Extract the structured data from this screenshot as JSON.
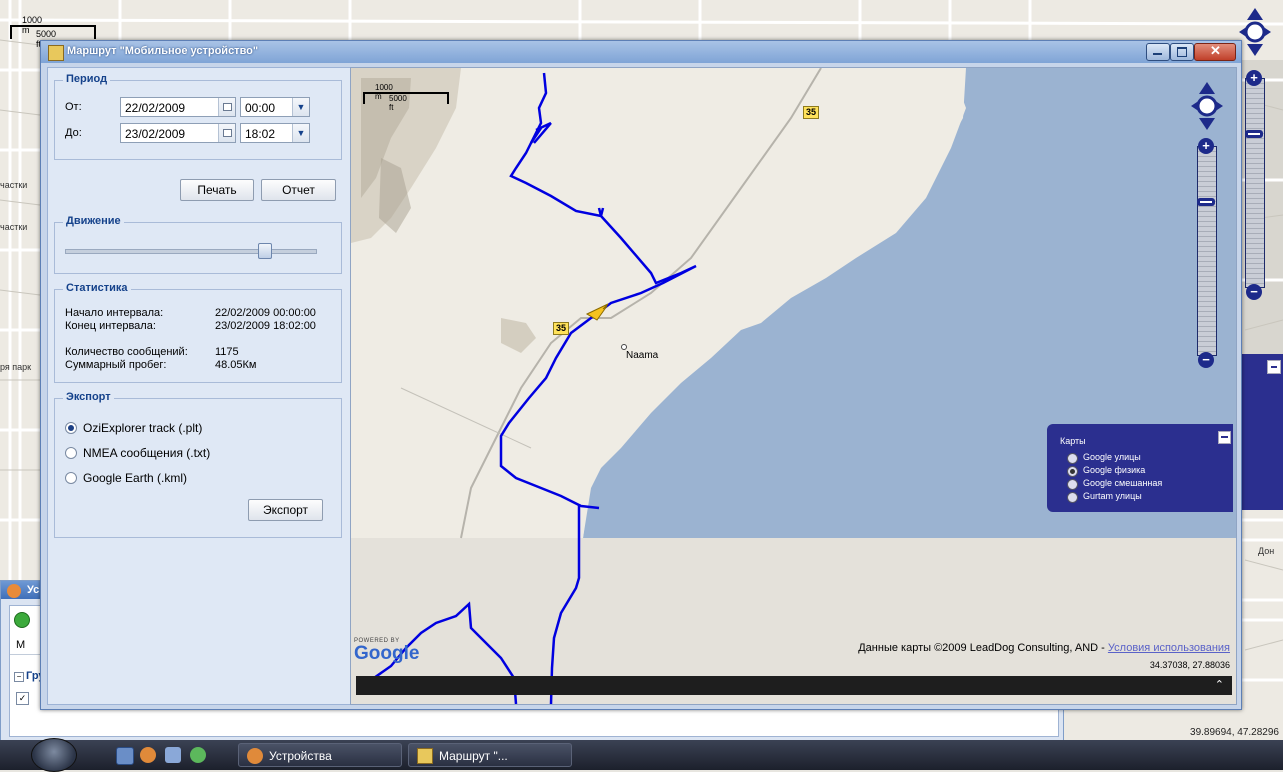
{
  "window": {
    "title": "Маршрут \"Мобильное устройство\""
  },
  "period": {
    "legend": "Период",
    "from_label": "От:",
    "from_date": "22/02/2009",
    "from_time": "00:00",
    "to_label": "До:",
    "to_date": "23/02/2009",
    "to_time": "18:02",
    "print_label": "Печать",
    "report_label": "Отчет"
  },
  "movement": {
    "legend": "Движение",
    "slider_position": 0.82
  },
  "stats": {
    "legend": "Статистика",
    "rows": [
      {
        "label": "Начало интервала:",
        "value": "22/02/2009 00:00:00"
      },
      {
        "label": "Конец интервала:",
        "value": "23/02/2009 18:02:00"
      },
      {
        "label": "Количество сообщений:",
        "value": "1175"
      },
      {
        "label": "Суммарный пробег:",
        "value": "48.05Км"
      }
    ]
  },
  "export": {
    "legend": "Экспорт",
    "options": [
      {
        "label": "OziExplorer track (.plt)",
        "selected": true
      },
      {
        "label": "NMEA сообщения (.txt)",
        "selected": false
      },
      {
        "label": "Google Earth (.kml)",
        "selected": false
      }
    ],
    "button_label": "Экспорт"
  },
  "map": {
    "scale_m": "1000 m",
    "scale_ft": "5000 ft",
    "road_label": "35",
    "place_label": "Naama",
    "layers_title": "Карты",
    "layers": [
      {
        "label": "Google улицы",
        "selected": false
      },
      {
        "label": "Google физика",
        "selected": true
      },
      {
        "label": "Google смешанная",
        "selected": false
      },
      {
        "label": "Gurtam улицы",
        "selected": false
      }
    ],
    "attribution": "Данные карты ©2009 LeadDog Consulting, AND - ",
    "terms_link": "Условия использования",
    "coords": "34.37038, 27.88036",
    "powered_by": "POWERED BY",
    "google": "Google",
    "colors": {
      "water": "#9bb3d1",
      "land": "#efece4",
      "track": "#0000e0"
    }
  },
  "background": {
    "scale_m": "1000 m",
    "scale_ft": "5000 ft",
    "labels": [
      "частки",
      "частки",
      "ря парк",
      "Дон"
    ],
    "coords": "39.89694, 47.28296",
    "under_window_title": "Ус",
    "under_col": "M",
    "under_group": "Гру"
  },
  "taskbar": {
    "items": [
      {
        "label": "Устройства"
      },
      {
        "label": "Маршрут \"..."
      }
    ]
  }
}
